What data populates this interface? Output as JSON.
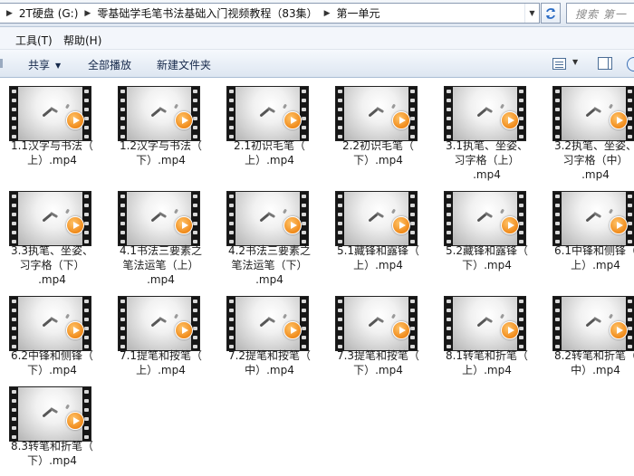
{
  "address": {
    "crumbs": [
      "2T硬盘 (G:)",
      "零基础学毛笔书法基础入门视频教程（83集）",
      "第一单元"
    ],
    "search_placeholder": "搜索 第一"
  },
  "menu": {
    "tools": "工具(T)",
    "help": "帮助(H)"
  },
  "toolbar": {
    "share": "共享",
    "play_all": "全部播放",
    "new_folder": "新建文件夹"
  },
  "files": [
    "1.1汉字与书法（\n上）.mp4",
    "1.2汉字与书法（\n下）.mp4",
    "2.1初识毛笔（\n上）.mp4",
    "2.2初识毛笔（\n下）.mp4",
    "3.1执笔、坐姿、\n习字格（上）\n.mp4",
    "3.2执笔、坐姿、\n习字格（中）\n.mp4",
    "3.3执笔、坐姿、\n习字格（下）\n.mp4",
    "4.1书法三要素之\n笔法运笔（上）\n.mp4",
    "4.2书法三要素之\n笔法运笔（下）\n.mp4",
    "5.1藏锋和露锋（\n上）.mp4",
    "5.2藏锋和露锋（\n下）.mp4",
    "6.1中锋和侧锋（\n上）.mp4",
    "6.2中锋和侧锋（\n下）.mp4",
    "7.1提笔和按笔（\n上）.mp4",
    "7.2提笔和按笔（\n中）.mp4",
    "7.3提笔和按笔（\n下）.mp4",
    "8.1转笔和折笔（\n上）.mp4",
    "8.2转笔和折笔（\n中）.mp4",
    "8.3转笔和折笔（\n下）.mp4"
  ]
}
